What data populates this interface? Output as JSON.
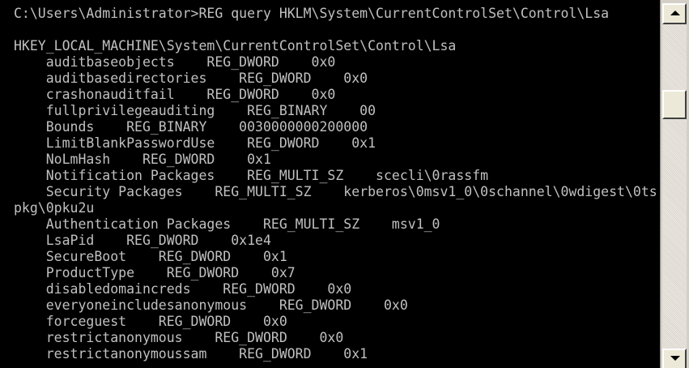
{
  "console": {
    "lines": [
      "C:\\Users\\Administrator>REG query HKLM\\System\\CurrentControlSet\\Control\\Lsa",
      "",
      "HKEY_LOCAL_MACHINE\\System\\CurrentControlSet\\Control\\Lsa",
      "    auditbaseobjects    REG_DWORD    0x0",
      "    auditbasedirectories    REG_DWORD    0x0",
      "    crashonauditfail    REG_DWORD    0x0",
      "    fullprivilegeauditing    REG_BINARY    00",
      "    Bounds    REG_BINARY    0030000000200000",
      "    LimitBlankPasswordUse    REG_DWORD    0x1",
      "    NoLmHash    REG_DWORD    0x1",
      "    Notification Packages    REG_MULTI_SZ    scecli\\0rassfm",
      "    Security Packages    REG_MULTI_SZ    kerberos\\0msv1_0\\0schannel\\0wdigest\\0ts",
      "pkg\\0pku2u",
      "    Authentication Packages    REG_MULTI_SZ    msv1_0",
      "    LsaPid    REG_DWORD    0x1e4",
      "    SecureBoot    REG_DWORD    0x1",
      "    ProductType    REG_DWORD    0x7",
      "    disabledomaincreds    REG_DWORD    0x0",
      "    everyoneincludesanonymous    REG_DWORD    0x0",
      "    forceguest    REG_DWORD    0x0",
      "    restrictanonymous    REG_DWORD    0x0",
      "    restrictanonymoussam    REG_DWORD    0x1"
    ]
  },
  "colors": {
    "background": "#000000",
    "text": "#c0c0c0",
    "scrollbar": "#d4d0c8"
  },
  "icons": {
    "scroll_up": "arrow-up-icon",
    "scroll_down": "arrow-down-icon"
  }
}
